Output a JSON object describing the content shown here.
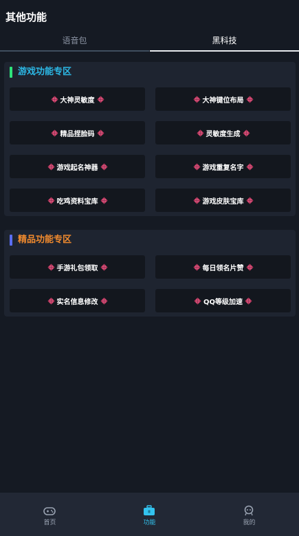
{
  "header": {
    "title": "其他功能"
  },
  "tabs": [
    {
      "label": "语音包",
      "active": false
    },
    {
      "label": "黑科技",
      "active": true
    }
  ],
  "sections": [
    {
      "title": "游戏功能专区",
      "buttons": [
        "大神灵敏度",
        "大神键位布局",
        "精品捏脸码",
        "灵敏度生成",
        "游戏起名神器",
        "游戏重复名字",
        "吃鸡资料宝库",
        "游戏皮肤宝库"
      ]
    },
    {
      "title": "精品功能专区",
      "buttons": [
        "手游礼包领取",
        "每日领名片赞",
        "实名信息修改",
        "QQ等级加速"
      ]
    }
  ],
  "bottom_nav": [
    {
      "label": "首页",
      "icon": "gamepad-icon"
    },
    {
      "label": "功能",
      "icon": "toolbox-icon",
      "active": true
    },
    {
      "label": "我的",
      "icon": "robot-face-icon"
    }
  ],
  "colors": {
    "accent_blue": "#2cb8e6",
    "accent_orange": "#f08a2e",
    "bar_green": "#2ee37a",
    "bar_purple": "#5a6df2",
    "gem_pink": "#d2456e"
  }
}
